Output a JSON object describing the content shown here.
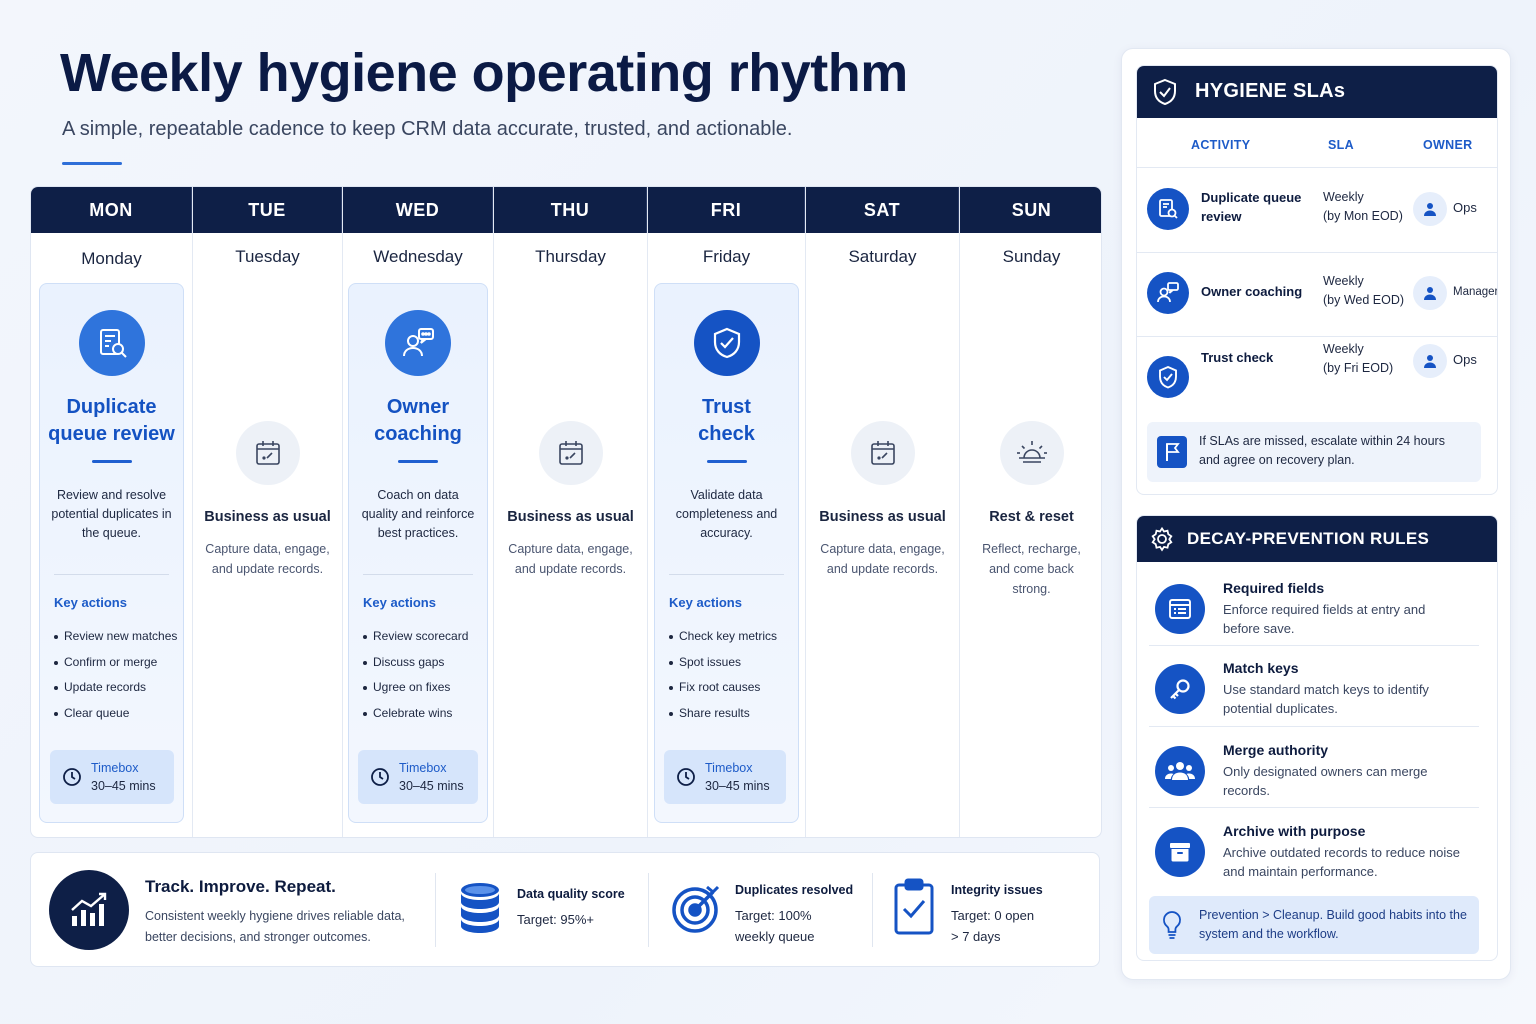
{
  "header": {
    "title": "Weekly hygiene operating rhythm",
    "subtitle": "A simple, repeatable cadence to keep CRM data accurate, trusted, and actionable."
  },
  "colors": {
    "navy": "#0e1f47",
    "accent_blue": "#1553c4",
    "light_blue": "#eaf2fe"
  },
  "days": [
    {
      "abbr": "MON",
      "full": "Monday",
      "type": "activity",
      "icon": "document-search-icon",
      "title_line1": "Duplicate",
      "title_line2": "queue review",
      "desc": "Review and resolve potential duplicates in the queue.",
      "key_actions_label": "Key actions",
      "actions": [
        "Review new matches",
        "Confirm or merge",
        "Update records",
        "Clear queue"
      ],
      "timebox_label": "Timebox",
      "timebox_value": "30–45 mins"
    },
    {
      "abbr": "TUE",
      "full": "Tuesday",
      "type": "bau",
      "icon": "calendar-icon",
      "bau_title": "Business as usual",
      "bau_desc": "Capture data, engage, and update records."
    },
    {
      "abbr": "WED",
      "full": "Wednesday",
      "type": "activity",
      "icon": "coaching-icon",
      "title_line1": "Owner",
      "title_line2": "coaching",
      "desc": "Coach on data quality and reinforce best practices.",
      "key_actions_label": "Key actions",
      "actions": [
        "Review scorecard",
        "Discuss gaps",
        "Ugree on fixes",
        "Celebrate wins"
      ],
      "timebox_label": "Timebox",
      "timebox_value": "30–45 mins"
    },
    {
      "abbr": "THU",
      "full": "Thursday",
      "type": "bau",
      "icon": "calendar-icon",
      "bau_title": "Business as usual",
      "bau_desc": "Capture data, engage, and update records."
    },
    {
      "abbr": "FRI",
      "full": "Friday",
      "type": "activity",
      "icon": "shield-check-icon",
      "title_line1": "Trust",
      "title_line2": "check",
      "desc": "Validate data completeness and accuracy.",
      "key_actions_label": "Key actions",
      "actions": [
        "Check key metrics",
        "Spot issues",
        "Fix root causes",
        "Share results"
      ],
      "timebox_label": "Timebox",
      "timebox_value": "30–45 mins"
    },
    {
      "abbr": "SAT",
      "full": "Saturday",
      "type": "bau",
      "icon": "calendar-icon",
      "bau_title": "Business as usual",
      "bau_desc": "Capture data, engage, and update records."
    },
    {
      "abbr": "SUN",
      "full": "Sunday",
      "type": "bau",
      "icon": "sunrise-icon",
      "bau_title": "Rest & reset",
      "bau_desc": "Reflect, recharge, and come back strong."
    }
  ],
  "footer": {
    "title": "Track. Improve. Repeat.",
    "desc": "Consistent weekly hygiene drives reliable data, better decisions, and stronger outcomes.",
    "metrics": [
      {
        "label": "Data quality score",
        "target": "Target: 95%+",
        "icon": "database-icon"
      },
      {
        "label": "Duplicates resolved",
        "target_line1": "Target: 100%",
        "target_line2": "weekly queue",
        "icon": "target-icon"
      },
      {
        "label": "Integrity issues",
        "target_line1": "Target: 0 open",
        "target_line2": "> 7 days",
        "icon": "clipboard-check-icon"
      }
    ]
  },
  "sla": {
    "title": "HYGIENE SLAs",
    "columns": [
      "ACTIVITY",
      "SLA",
      "OWNER"
    ],
    "rows": [
      {
        "activity_line1": "Duplicate queue",
        "activity_line2": "review",
        "sla_line1": "Weekly",
        "sla_line2": "(by Mon EOD)",
        "owner": "Ops"
      },
      {
        "activity_line1": "Owner coaching",
        "activity_line2": "",
        "sla_line1": "Weekly",
        "sla_line2": "(by Wed EOD)",
        "owner": "Manager"
      },
      {
        "activity_line1": "Trust check",
        "activity_line2": "",
        "sla_line1": "Weekly",
        "sla_line2": "(by Fri EOD)",
        "owner": "Ops"
      }
    ],
    "note": "If SLAs are missed, escalate within 24 hours and agree on recovery plan."
  },
  "decay": {
    "title": "DECAY-PREVENTION RULES",
    "rules": [
      {
        "title": "Required fields",
        "desc": "Enforce required fields at entry and before save.",
        "icon": "form-icon"
      },
      {
        "title": "Match keys",
        "desc": "Use standard match keys to identify potential duplicates.",
        "icon": "key-icon"
      },
      {
        "title": "Merge authority",
        "desc": "Only designated owners can merge records.",
        "icon": "users-icon"
      },
      {
        "title": "Archive with purpose",
        "desc": "Archive outdated records to reduce noise and maintain performance.",
        "icon": "archive-icon"
      }
    ],
    "note": "Prevention > Cleanup. Build good habits into the system and the workflow."
  }
}
